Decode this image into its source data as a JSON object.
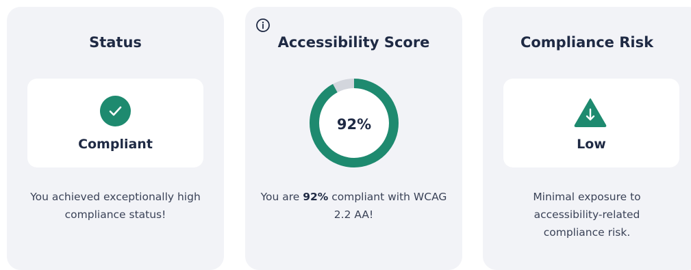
{
  "status_card": {
    "title": "Status",
    "state_label": "Compliant",
    "description": "You achieved exceptionally high compliance status!"
  },
  "score_card": {
    "title": "Accessibility Score",
    "score_label": "92%",
    "score_value": 92,
    "description_prefix": "You are ",
    "description_bold": "92%",
    "description_suffix": " compliant with WCAG 2.2 AA!"
  },
  "risk_card": {
    "title": "Compliance Risk",
    "level_label": "Low",
    "description": "Minimal exposure to accessibility-related compliance risk."
  },
  "colors": {
    "accent": "#1e8a6f",
    "track": "#d3d6dd",
    "card_bg": "#f2f3f7",
    "text": "#1f2a44"
  },
  "icons": {
    "status": "check-circle-icon",
    "score_info": "info-icon",
    "risk": "arrow-down-triangle-icon"
  }
}
